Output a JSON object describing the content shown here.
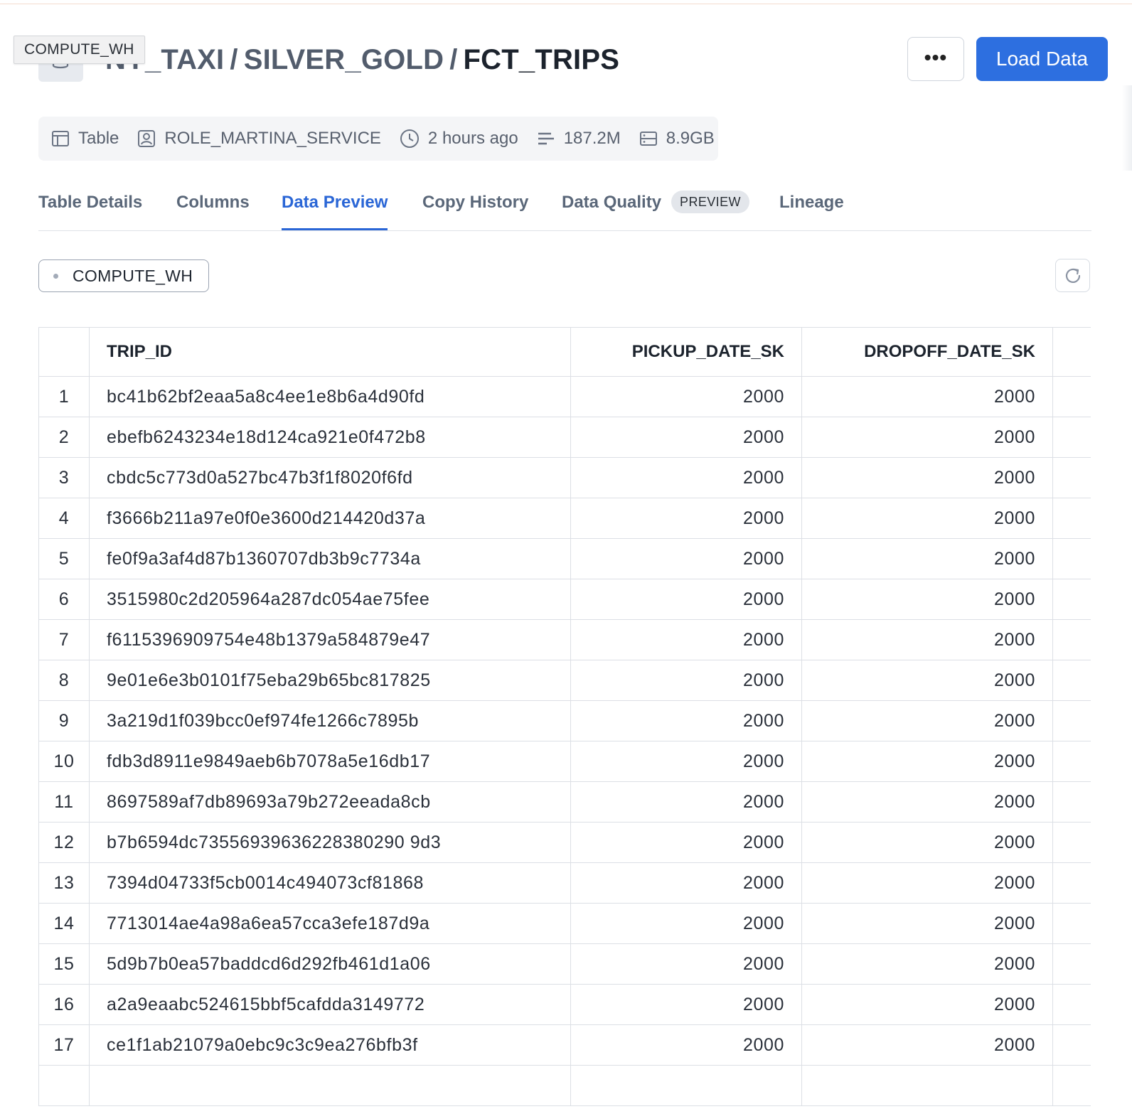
{
  "tooltip": "COMPUTE_WH",
  "header": {
    "breadcrumb": [
      {
        "label": "NY_TAXI"
      },
      {
        "label": "SILVER_GOLD"
      },
      {
        "label": "FCT_TRIPS"
      }
    ],
    "separator": "/",
    "more_label": "•••",
    "load_label": "Load Data"
  },
  "meta": {
    "type": "Table",
    "owner": "ROLE_MARTINA_SERVICE",
    "updated": "2 hours ago",
    "rows": "187.2M",
    "size": "8.9GB"
  },
  "tabs": [
    {
      "label": "Table Details"
    },
    {
      "label": "Columns"
    },
    {
      "label": "Data Preview"
    },
    {
      "label": "Copy History"
    },
    {
      "label": "Data Quality",
      "badge": "PREVIEW"
    },
    {
      "label": "Lineage"
    }
  ],
  "active_tab": "Data Preview",
  "warehouse": "COMPUTE_WH",
  "columns": [
    "TRIP_ID",
    "PICKUP_DATE_SK",
    "DROPOFF_DATE_SK"
  ],
  "rows": [
    {
      "idx": "1",
      "trip_id": "bc41b62bf2eaa5a8c4ee1e8b6a4d90fd",
      "pickup": "2000",
      "dropoff": "2000"
    },
    {
      "idx": "2",
      "trip_id": "ebefb6243234e18d124ca921e0f472b8",
      "pickup": "2000",
      "dropoff": "2000"
    },
    {
      "idx": "3",
      "trip_id": "cbdc5c773d0a527bc47b3f1f8020f6fd",
      "pickup": "2000",
      "dropoff": "2000"
    },
    {
      "idx": "4",
      "trip_id": "f3666b211a97e0f0e3600d214420d37a",
      "pickup": "2000",
      "dropoff": "2000"
    },
    {
      "idx": "5",
      "trip_id": "fe0f9a3af4d87b1360707db3b9c7734a",
      "pickup": "2000",
      "dropoff": "2000"
    },
    {
      "idx": "6",
      "trip_id": "3515980c2d205964a287dc054ae75fee",
      "pickup": "2000",
      "dropoff": "2000"
    },
    {
      "idx": "7",
      "trip_id": "f6115396909754e48b1379a584879e47",
      "pickup": "2000",
      "dropoff": "2000"
    },
    {
      "idx": "8",
      "trip_id": "9e01e6e3b0101f75eba29b65bc817825",
      "pickup": "2000",
      "dropoff": "2000"
    },
    {
      "idx": "9",
      "trip_id": "3a219d1f039bcc0ef974fe1266c7895b",
      "pickup": "2000",
      "dropoff": "2000"
    },
    {
      "idx": "10",
      "trip_id": "fdb3d8911e9849aeb6b7078a5e16db17",
      "pickup": "2000",
      "dropoff": "2000"
    },
    {
      "idx": "11",
      "trip_id": "8697589af7db89693a79b272eeada8cb",
      "pickup": "2000",
      "dropoff": "2000"
    },
    {
      "idx": "12",
      "trip_id": "b7b6594dc73556939636228380290 9d3",
      "pickup": "2000",
      "dropoff": "2000"
    },
    {
      "idx": "13",
      "trip_id": "7394d04733f5cb0014c494073cf81868",
      "pickup": "2000",
      "dropoff": "2000"
    },
    {
      "idx": "14",
      "trip_id": "7713014ae4a98a6ea57cca3efe187d9a",
      "pickup": "2000",
      "dropoff": "2000"
    },
    {
      "idx": "15",
      "trip_id": "5d9b7b0ea57baddcd6d292fb461d1a06",
      "pickup": "2000",
      "dropoff": "2000"
    },
    {
      "idx": "16",
      "trip_id": "a2a9eaabc524615bbf5cafdda3149772",
      "pickup": "2000",
      "dropoff": "2000"
    },
    {
      "idx": "17",
      "trip_id": "ce1f1ab21079a0ebc9c3c9ea276bfb3f",
      "pickup": "2000",
      "dropoff": "2000"
    },
    {
      "idx": "",
      "trip_id": "",
      "pickup": "",
      "dropoff": ""
    }
  ],
  "colors": {
    "accent": "#2d6fe0",
    "active_tab": "#2a66d6",
    "text": "#1e252f",
    "muted": "#5a6779"
  },
  "icons": {
    "db": "database-icon",
    "type": "table-icon",
    "owner": "user-badge-icon",
    "updated": "clock-icon",
    "rows": "rows-icon",
    "size": "storage-icon",
    "refresh": "refresh-icon"
  }
}
